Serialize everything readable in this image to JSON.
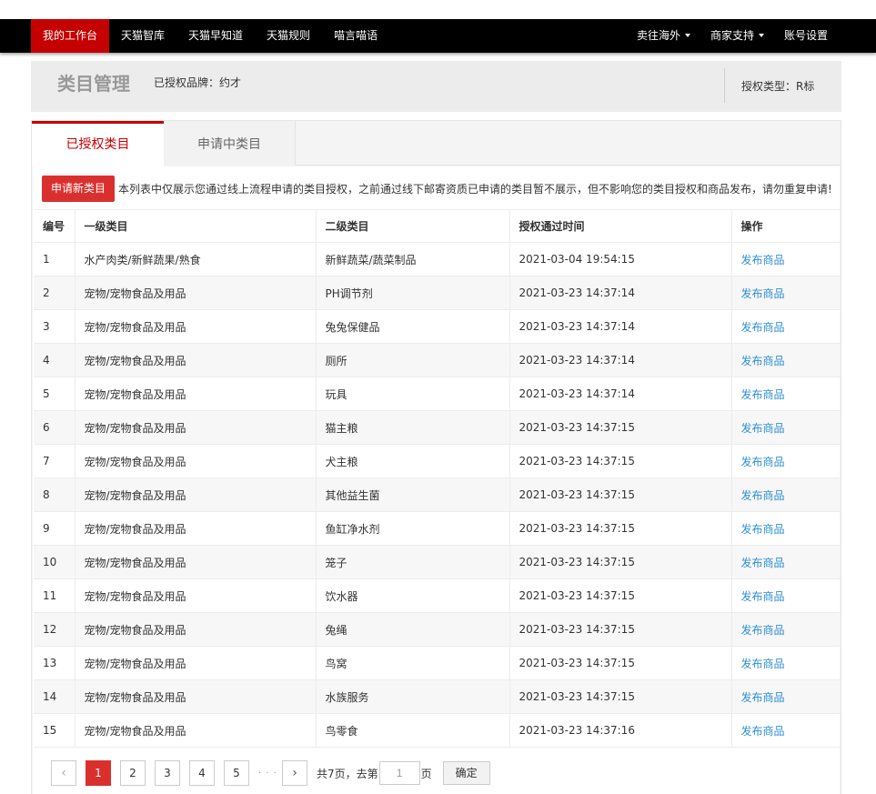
{
  "nav": {
    "left": [
      "我的工作台",
      "天猫智库",
      "天猫早知道",
      "天猫规则",
      "喵言喵语"
    ],
    "right": [
      "卖往海外",
      "商家支持",
      "账号设置"
    ]
  },
  "header": {
    "title": "类目管理",
    "brand": "已授权品牌：约才",
    "auth_type": "授权类型：R标"
  },
  "tabs": {
    "active": "已授权类目",
    "inactive": "申请中类目"
  },
  "notice": {
    "button": "申请新类目",
    "text": "本列表中仅展示您通过线上流程申请的类目授权，之前通过线下邮寄资质已申请的类目暂不展示，但不影响您的类目授权和商品发布，请勿重复申请!"
  },
  "table": {
    "headers": [
      "编号",
      "一级类目",
      "二级类目",
      "授权通过时间",
      "操作"
    ],
    "rows": [
      [
        "1",
        "水产肉类/新鲜蔬果/熟食",
        "新鲜蔬菜/蔬菜制品",
        "2021-03-04 19:54:15",
        "发布商品"
      ],
      [
        "2",
        "宠物/宠物食品及用品",
        "PH调节剂",
        "2021-03-23 14:37:14",
        "发布商品"
      ],
      [
        "3",
        "宠物/宠物食品及用品",
        "兔兔保健品",
        "2021-03-23 14:37:14",
        "发布商品"
      ],
      [
        "4",
        "宠物/宠物食品及用品",
        "厕所",
        "2021-03-23 14:37:14",
        "发布商品"
      ],
      [
        "5",
        "宠物/宠物食品及用品",
        "玩具",
        "2021-03-23 14:37:14",
        "发布商品"
      ],
      [
        "6",
        "宠物/宠物食品及用品",
        "猫主粮",
        "2021-03-23 14:37:15",
        "发布商品"
      ],
      [
        "7",
        "宠物/宠物食品及用品",
        "犬主粮",
        "2021-03-23 14:37:15",
        "发布商品"
      ],
      [
        "8",
        "宠物/宠物食品及用品",
        "其他益生菌",
        "2021-03-23 14:37:15",
        "发布商品"
      ],
      [
        "9",
        "宠物/宠物食品及用品",
        "鱼缸净水剂",
        "2021-03-23 14:37:15",
        "发布商品"
      ],
      [
        "10",
        "宠物/宠物食品及用品",
        "笼子",
        "2021-03-23 14:37:15",
        "发布商品"
      ],
      [
        "11",
        "宠物/宠物食品及用品",
        "饮水器",
        "2021-03-23 14:37:15",
        "发布商品"
      ],
      [
        "12",
        "宠物/宠物食品及用品",
        "兔绳",
        "2021-03-23 14:37:15",
        "发布商品"
      ],
      [
        "13",
        "宠物/宠物食品及用品",
        "鸟窝",
        "2021-03-23 14:37:15",
        "发布商品"
      ],
      [
        "14",
        "宠物/宠物食品及用品",
        "水族服务",
        "2021-03-23 14:37:15",
        "发布商品"
      ],
      [
        "15",
        "宠物/宠物食品及用品",
        "鸟零食",
        "2021-03-23 14:37:16",
        "发布商品"
      ]
    ]
  },
  "pager": {
    "prev": "‹",
    "next": "›",
    "pages": [
      "1",
      "2",
      "3",
      "4",
      "5"
    ],
    "current": "1",
    "ellipsis": "· · ·",
    "total_text": "共7页，去第",
    "goto_value": "1",
    "page_unit": "页",
    "confirm": "确定"
  }
}
